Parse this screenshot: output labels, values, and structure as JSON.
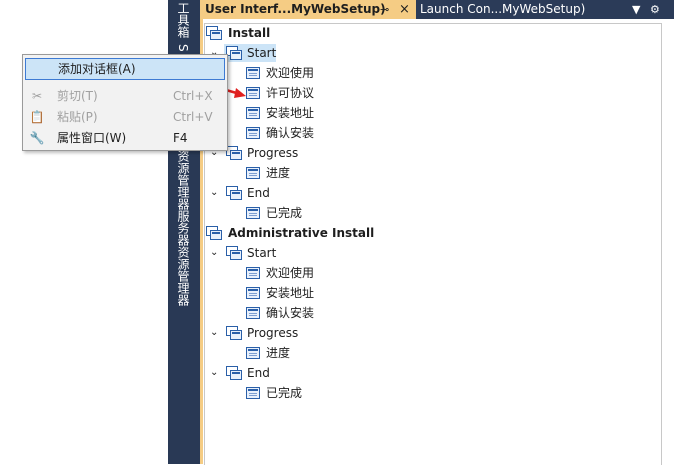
{
  "side_tabs": [
    "工具箱",
    "S",
    "资源管理器",
    "服务器资源管理器"
  ],
  "tabs": [
    {
      "label": "User Interf...MyWebSetup)",
      "active": true,
      "pin": "⊸",
      "close": "×"
    },
    {
      "label": "Launch Con...MyWebSetup)",
      "active": false
    }
  ],
  "tab_controls": {
    "dropdown": "▼",
    "settings": "⚙"
  },
  "tree": {
    "install": {
      "label": "Install",
      "start": {
        "label": "Start",
        "children": [
          "欢迎使用",
          "许可协议",
          "安装地址",
          "确认安装"
        ]
      },
      "progress": {
        "label": "Progress",
        "children": [
          "进度"
        ]
      },
      "end": {
        "label": "End",
        "children": [
          "已完成"
        ]
      }
    },
    "admin": {
      "label": "Administrative Install",
      "start": {
        "label": "Start",
        "children": [
          "欢迎使用",
          "安装地址",
          "确认安装"
        ]
      },
      "progress": {
        "label": "Progress",
        "children": [
          "进度"
        ]
      },
      "end": {
        "label": "End",
        "children": [
          "已完成"
        ]
      }
    }
  },
  "context_menu": {
    "items": [
      {
        "label": "添加对话框(A)",
        "shortcut": "",
        "icon": "",
        "enabled": true,
        "highlighted": true
      },
      {
        "label": "剪切(T)",
        "shortcut": "Ctrl+X",
        "icon": "scissors-icon",
        "enabled": false
      },
      {
        "label": "粘贴(P)",
        "shortcut": "Ctrl+V",
        "icon": "clipboard-icon",
        "enabled": false
      },
      {
        "label": "属性窗口(W)",
        "shortcut": "F4",
        "icon": "wrench-icon",
        "enabled": true
      }
    ]
  },
  "colors": {
    "accent_tab": "#f5cc84",
    "chrome": "#293955",
    "selection": "#cce4f7",
    "arrow": "#e02020"
  }
}
